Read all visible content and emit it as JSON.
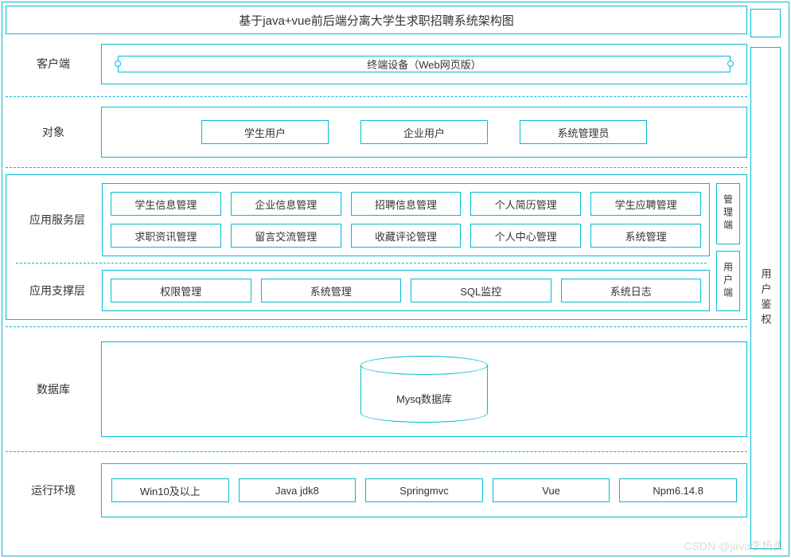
{
  "title": "基于java+vue前后端分离大学生求职招聘系统架构图",
  "client": {
    "label": "客户端",
    "terminal": "终端设备（Web网页版）"
  },
  "objects": {
    "label": "对象",
    "items": [
      "学生用户",
      "企业用户",
      "系统管理员"
    ]
  },
  "service": {
    "label": "应用服务层",
    "rows": [
      [
        "学生信息管理",
        "企业信息管理",
        "招聘信息管理",
        "个人简历管理",
        "学生应聘管理"
      ],
      [
        "求职资讯管理",
        "留言交流管理",
        "收藏评论管理",
        "个人中心管理",
        "系统管理"
      ]
    ]
  },
  "support": {
    "label": "应用支撑层",
    "items": [
      "权限管理",
      "系统管理",
      "SQL监控",
      "系统日志"
    ]
  },
  "side_tabs": {
    "admin": "管理端",
    "user": "用户端"
  },
  "db": {
    "label": "数据库",
    "name": "Mysq数据库"
  },
  "env": {
    "label": "运行环境",
    "items": [
      "Win10及以上",
      "Java jdk8",
      "Springmvc",
      "Vue",
      "Npm6.14.8"
    ]
  },
  "auth": "用户鉴权",
  "watermark": "CSDN @java李杨勇"
}
